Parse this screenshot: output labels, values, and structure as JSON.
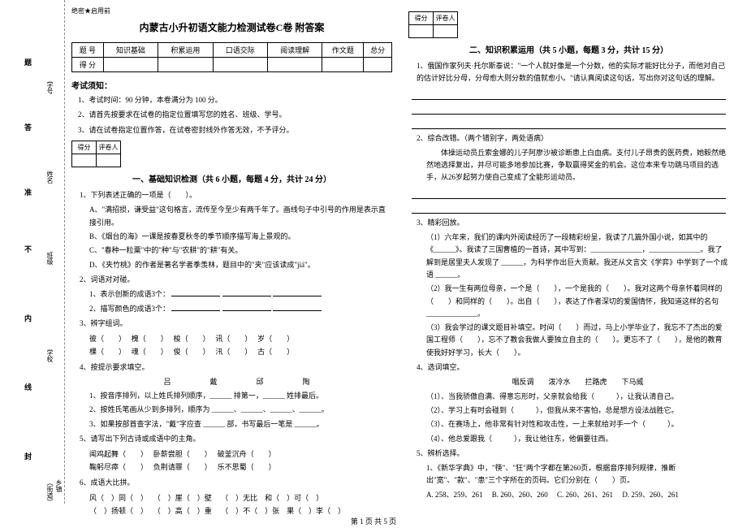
{
  "binding": {
    "field_labels": [
      "乡镇（街道）",
      "学校",
      "班级",
      "姓名",
      "学号"
    ],
    "side_chars": [
      "封",
      "线",
      "内",
      "不",
      "准",
      "答",
      "题"
    ],
    "dash_text": "┆┆┆┆┆"
  },
  "header": {
    "secret": "绝密★启用前",
    "title": "内蒙古小升初语文能力检测试卷C卷 附答案"
  },
  "score_table": {
    "headers": [
      "题 号",
      "知识基础",
      "积累运用",
      "口语交际",
      "阅读理解",
      "作文题",
      "总分"
    ],
    "row2": "得 分"
  },
  "notice": {
    "title": "考试须知：",
    "items": [
      "1、考试时间：90 分钟，本卷满分为 100 分。",
      "2、请首先按要求在试卷的指定位置填写您的姓名、班级、学号。",
      "3、请在试卷指定位置作答，在试卷密封线外作答无效，不予评分。"
    ]
  },
  "sec1": {
    "title": "一、基础知识检测（共 6 小题，每题 4 分，共计 24 分）",
    "q1": "1、下列表述正确的一项是（　　）。",
    "q1a": "A、\"满招损，谦受益\"这句格言，流传至今至少有两千年了。画线句子中引号的作用是表示直接引用。",
    "q1b": "B、《烟台的海》一课是按春夏秋冬的季节顺序描写海上景观的。",
    "q1c": "C、\"春种一粒粟\"中的\"种\"与\"农耕\"的\"耕\"有关。",
    "q1d": "D、《夹竹桃》的作者是著名学者季羡林，题目中的\"夹\"应该读成\"jiá\"。",
    "q2": "2、词语对对碰。",
    "q2a": "1、表示创新的成语3个：",
    "q2b": "2、描写颜色的成语3个：",
    "q3": "3、辨字组词。",
    "q3row1": [
      "彼（　　）",
      "槐（　　）",
      "梭（　　）",
      "讯（　　）",
      "岁（　　）"
    ],
    "q3row2": [
      "棵（　　）",
      "魂（　　）",
      "俊（　　）",
      "汛（　　）",
      "古（　　）"
    ],
    "q4": "4、按提示要求填空。",
    "q4names": "吕　　戴　　邱　　陶",
    "q4a": "1、按音序排列，以上姓氏排列顺序，______ 排第一，______ 姓排最后。",
    "q4b": "2、按姓氏笔画从少到多排列，顺序为 ______、______、______、______。",
    "q4c": "3、如果按部首查字法，\"戴\"字应查 ______ 部，书写最后一笔是 ______。",
    "q5": "5、请写出下列古诗或成语中的主角。",
    "q5row1": [
      "闻鸡起舞（　　）",
      "卧薪尝胆（　　）",
      "破釜沉舟（　　）"
    ],
    "q5row2": [
      "鞠躬尽瘁（　　）",
      "负荆请罪（　　）",
      "乐不思蜀（　　）"
    ],
    "q6": "6、成语大比拼。",
    "q6row1": [
      "风（　）同（　）",
      "（　）崖（　）壁",
      "（　）无比　和（　）可（　）"
    ],
    "q6row2": [
      "（　）扬顿（　）",
      "（　）高（　）重",
      "（　）不（　）张　果（　）李（　）"
    ]
  },
  "sec2": {
    "small_score": [
      "得分",
      "评卷人"
    ],
    "title": "二、知识积累运用（共 5 小题，每题 3 分，共计 15 分）",
    "q1": "1、俄国作家列夫·托尔斯泰说：\"一个人就好像是一个分数，他的实际才能好比分子，而他对自己的估计好比分母，分母愈大则分数的值就愈小。\"请认真阅读这句话，写出你对这句话的理解。",
    "q2": "2、综合改错。（两个错别字，两处语病）",
    "q2text": "体操运动员丘索金娜的儿子阿廖沙被诊断患上白血病。支付儿子昂贵的医药费，她毅然绝然地选择复出，并尽可能多地参加比赛，争取赢得奖金的机会。这位本来专功跳马项目的选手，从26岁起努力使自己变成了全能形运动员。",
    "q3": "3、精彩回放。",
    "q3a": "（1）六年来，我们的课内外阅读经历了一段精彩纷呈，我读了几篇外国小说，如其中的《______》。我读了三国曹植的一首诗，其中写到：______________，______________。我了解到是居里夫人发现了 ______，为科学作出巨大贡献。我还从文言文《学弈》中学到了一个成语 ______。",
    "q3b": "（2）我一生有两位母亲，一个是（　　），一个是我的（　　）。我对这两个母亲怀着同样的（　　）和同样的（　　）。出自（　　），表达了作者深切的爱国情怀，我知道这样的名句 ______________。",
    "q3c": "（3）我会学过的课文题目补填空。时间（　　）而过，马上小学毕业了，我忘不了杰出的爱国工程师（　　），忘不了教会我做人要独立自主的（　　）。更忘不了（　　），是他的教育使我好好学习，长大（　　）。",
    "q4": "4、选词填空。",
    "q4words": "唱反调　　泼冷水　　拦路虎　　下马威",
    "q4a": "（1）、当我骄傲自满、得意忘形时，父亲就会给我（　　　），让我认清自己。",
    "q4b": "（2）、学习上有时会碰到（　　　），但我从来不害怕，总是想方设法战胜它。",
    "q4c": "（3）、在赛场上，他非常有针对性和攻击性，一上来就给对手一个（　　　）。",
    "q4d": "（4）、他总爱跟我（　　　），我让他往东，他偏要往西。",
    "q5": "5、辨析选择。",
    "q5text": "1、《新华字典》中，\"筷\"、\"狂\"两个字都在第260页，根据音序排列规律，推断出\"宽\"、\"款\"、\"患\"三个字所在的页码。它们分别在（　　）页。",
    "q5opts": [
      "A. 258、259、261",
      "B. 260、260、260",
      "C. 260、261、261",
      "D. 259、260、261"
    ]
  },
  "footer": "第 1 页 共 5 页"
}
